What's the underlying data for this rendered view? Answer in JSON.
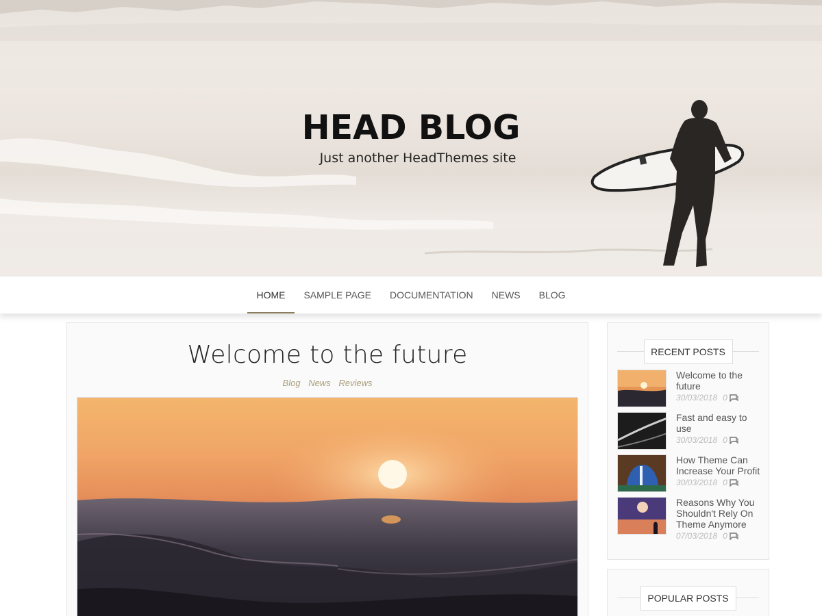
{
  "header": {
    "site_title": "HEAD BLOG",
    "tagline": "Just another HeadThemes site"
  },
  "nav": {
    "items": [
      {
        "label": "HOME",
        "active": true
      },
      {
        "label": "SAMPLE PAGE",
        "active": false
      },
      {
        "label": "DOCUMENTATION",
        "active": false
      },
      {
        "label": "NEWS",
        "active": false
      },
      {
        "label": "BLOG",
        "active": false
      }
    ],
    "accent_color": "#8a7e5e"
  },
  "post": {
    "title": "Welcome to the future",
    "categories": [
      "Blog",
      "News",
      "Reviews"
    ],
    "category_color": "#a99e7a"
  },
  "sidebar": {
    "recent_posts": {
      "title": "RECENT POSTS",
      "items": [
        {
          "title": "Welcome to the future",
          "date": "30/03/2018",
          "comments": "0",
          "thumb": "sunset-sea"
        },
        {
          "title": "Fast and easy to use",
          "date": "30/03/2018",
          "comments": "0",
          "thumb": "dark-coast"
        },
        {
          "title": "How Theme Can Increase Your Profit",
          "date": "30/03/2018",
          "comments": "0",
          "thumb": "waterfall-cave"
        },
        {
          "title": "Reasons Why You Shouldn't Rely On Theme Anymore",
          "date": "07/03/2018",
          "comments": "0",
          "thumb": "lantern-night"
        }
      ]
    },
    "popular_posts": {
      "title": "POPULAR POSTS"
    }
  }
}
